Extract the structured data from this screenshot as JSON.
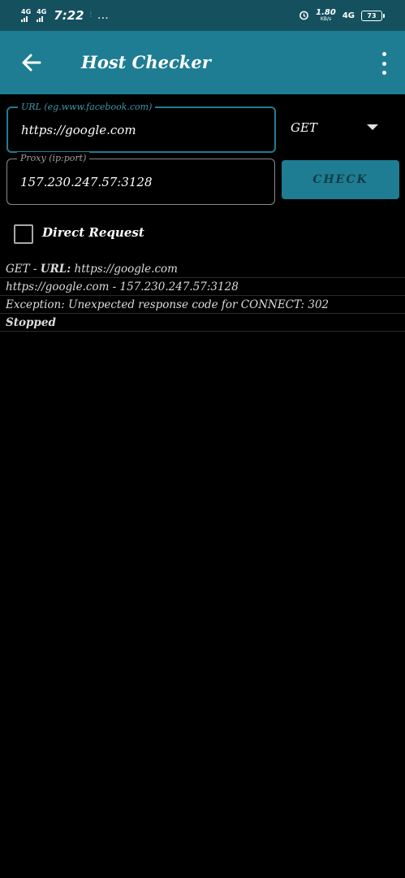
{
  "status_bar": {
    "network_1": "4G",
    "network_2": "4G",
    "time": "7:22",
    "extra": "…",
    "speed_value": "1.80",
    "speed_unit": "KB/s",
    "network_3": "4G",
    "battery": "73"
  },
  "app_bar": {
    "title": "Host Checker"
  },
  "form": {
    "url_label": "URL (eg.www.facebook.com)",
    "url_value": "https://google.com",
    "proxy_label": "Proxy (ip:port)",
    "proxy_value": "157.230.247.57:3128",
    "method": "GET",
    "check_label": "CHECK",
    "direct_request_label": "Direct Request",
    "direct_request_checked": false
  },
  "log": {
    "line1_method": "GET - ",
    "line1_key": "URL:",
    "line1_value": " https://google.com",
    "line2": "https://google.com - 157.230.247.57:3128",
    "line3": "Exception: Unexpected response code for CONNECT: 302",
    "line4": "Stopped"
  },
  "colors": {
    "status_bar": "#15505e",
    "app_bar": "#1e7d92",
    "accent": "#1e7d92",
    "background": "#000000"
  }
}
